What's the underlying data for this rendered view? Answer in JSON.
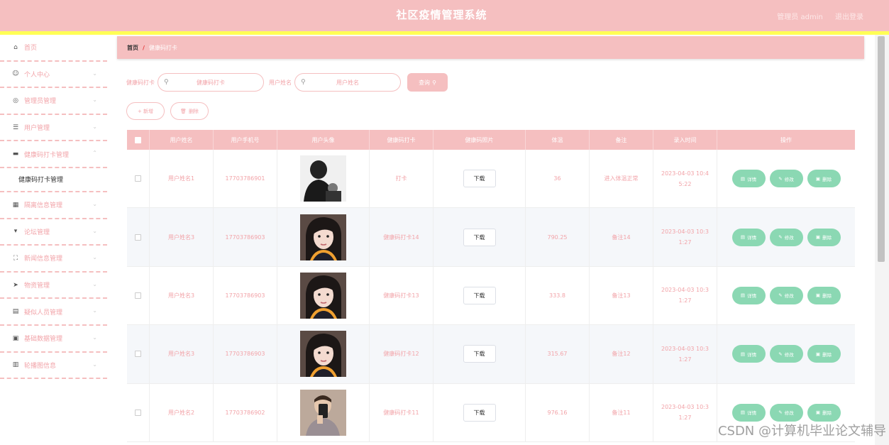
{
  "header": {
    "title": "社区疫情管理系统",
    "admin_label": "管理员 admin",
    "logout_label": "退出登录"
  },
  "sidebar": {
    "items": [
      {
        "label": "首页",
        "icon": "home-icon",
        "chevron": false
      },
      {
        "label": "个人中心",
        "icon": "user-icon",
        "chevron": true
      },
      {
        "label": "管理员管理",
        "icon": "globe-icon",
        "chevron": true
      },
      {
        "label": "用户管理",
        "icon": "sliders-icon",
        "chevron": true
      },
      {
        "label": "健康码打卡管理",
        "icon": "briefcase-icon",
        "chevron": true,
        "expanded": true
      },
      {
        "label": "隔离信息管理",
        "icon": "grid-icon",
        "chevron": true
      },
      {
        "label": "论坛管理",
        "icon": "pin-icon",
        "chevron": true
      },
      {
        "label": "新闻信息管理",
        "icon": "expand-icon",
        "chevron": true
      },
      {
        "label": "物资管理",
        "icon": "send-icon",
        "chevron": true
      },
      {
        "label": "疑似人员管理",
        "icon": "ticket-icon",
        "chevron": true
      },
      {
        "label": "基础数据管理",
        "icon": "printer-icon",
        "chevron": true
      },
      {
        "label": "轮播图信息",
        "icon": "clipboard-icon",
        "chevron": true
      }
    ],
    "sub_item": "健康码打卡管理"
  },
  "breadcrumb": {
    "home": "首页",
    "separator": "/",
    "current": "健康码打卡"
  },
  "search": {
    "label1": "健康码打卡",
    "placeholder1": "健康码打卡",
    "label2": "用户姓名",
    "placeholder2": "用户姓名",
    "button": "查询"
  },
  "actions": {
    "add": "+ 新增",
    "delete": "删除"
  },
  "table": {
    "headers": [
      "用户姓名",
      "用户手机号",
      "用户头像",
      "健康码打卡",
      "健康码照片",
      "体温",
      "备注",
      "录入时间",
      "操作"
    ],
    "download_label": "下载",
    "op_detail": "详情",
    "op_edit": "修改",
    "op_delete": "删除",
    "rows": [
      {
        "name": "用户姓名1",
        "phone": "17703786901",
        "avatar": "man-bw-photo",
        "punch": "打卡",
        "temp": "36",
        "note": "进入体温正常",
        "time": "2023-04-03 10:45:22",
        "time_l1": "2023-04-03 10:4",
        "time_l2": "5:22"
      },
      {
        "name": "用户姓名3",
        "phone": "17703786903",
        "avatar": "woman-photo",
        "punch": "健康码打卡14",
        "temp": "790.25",
        "note": "备注14",
        "time": "2023-04-03 10:31:27",
        "time_l1": "2023-04-03 10:3",
        "time_l2": "1:27"
      },
      {
        "name": "用户姓名3",
        "phone": "17703786903",
        "avatar": "woman-photo",
        "punch": "健康码打卡13",
        "temp": "333.8",
        "note": "备注13",
        "time": "2023-04-03 10:31:27",
        "time_l1": "2023-04-03 10:3",
        "time_l2": "1:27"
      },
      {
        "name": "用户姓名3",
        "phone": "17703786903",
        "avatar": "woman-photo",
        "punch": "健康码打卡12",
        "temp": "315.67",
        "note": "备注12",
        "time": "2023-04-03 10:31:27",
        "time_l1": "2023-04-03 10:3",
        "time_l2": "1:27"
      },
      {
        "name": "用户姓名2",
        "phone": "17703786902",
        "avatar": "selfie-photo",
        "punch": "健康码打卡11",
        "temp": "976.16",
        "note": "备注11",
        "time": "2023-04-03 10:31:27",
        "time_l1": "2023-04-03 10:3",
        "time_l2": "1:27"
      }
    ]
  },
  "watermark": "CSDN @计算机毕业论文辅导",
  "colors": {
    "primary": "#f5bfc0",
    "accent_yellow": "#ffff55",
    "text_pink": "#f2a3a8",
    "action_green": "#8bd8b3"
  }
}
